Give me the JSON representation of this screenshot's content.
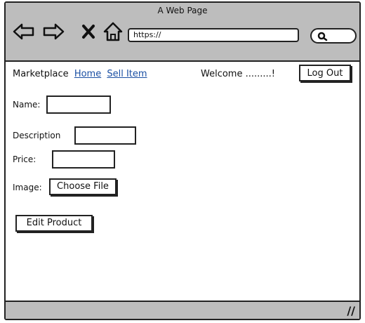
{
  "window": {
    "title": "A Web Page"
  },
  "browser": {
    "url": "https://"
  },
  "nav": {
    "brand": "Marketplace",
    "links": [
      "Home",
      "Sell Item"
    ],
    "welcome": "Welcome .........!",
    "logout_label": "Log Out"
  },
  "form": {
    "name_label": "Name:",
    "name_value": "",
    "description_label": "Description",
    "description_value": "",
    "price_label": "Price:",
    "price_value": "",
    "image_label": "Image:",
    "choose_file_label": "Choose File",
    "submit_label": "Edit Product"
  },
  "statusbar": {
    "grip_glyph": "//"
  }
}
